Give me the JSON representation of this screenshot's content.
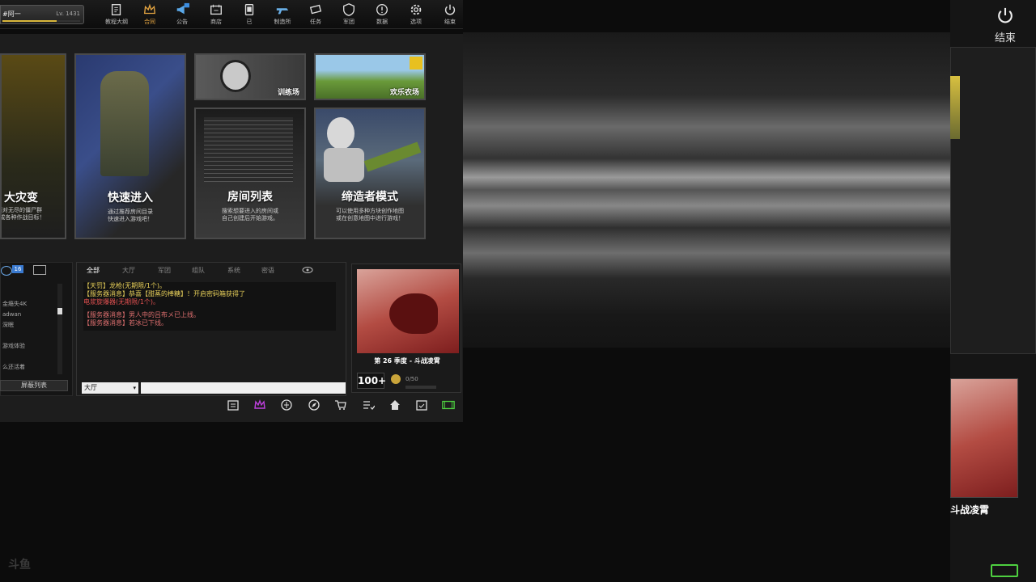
{
  "player": {
    "name": "#阿一",
    "level": "Lv. 1431",
    "exp_fraction": 0.7
  },
  "nav": [
    {
      "label": "教程大纲",
      "icon": "notepad-icon"
    },
    {
      "label": "合同",
      "icon": "crown-icon",
      "active": true
    },
    {
      "label": "公告",
      "icon": "megaphone-icon"
    },
    {
      "label": "商店",
      "icon": "cart-icon"
    },
    {
      "label": "已",
      "icon": "phone-icon"
    },
    {
      "label": "制造所",
      "icon": "gun-icon"
    },
    {
      "label": "任务",
      "icon": "ticket-icon"
    },
    {
      "label": "军团",
      "icon": "shield-icon"
    },
    {
      "label": "数据",
      "icon": "alert-icon"
    },
    {
      "label": "选项",
      "icon": "gear-icon"
    },
    {
      "label": "结束",
      "icon": "power-icon"
    }
  ],
  "exit_big": {
    "label": "结束"
  },
  "modes": {
    "zombie": {
      "title": "大灾变",
      "desc": "面对无尽的僵尸群\n完成各种作战目标！"
    },
    "quick": {
      "title": "快速进入",
      "desc": "通过推荐房间目录\n快速进入游戏吧！"
    },
    "rooms": {
      "title": "房间列表",
      "desc": "搜索想要进入的房间或\n自己创建后开始游戏。"
    },
    "creator": {
      "title": "缔造者模式",
      "desc": "可以使用多种方块创作地图\n或在创意地图中进行游戏！"
    },
    "training": {
      "title": "训练场"
    },
    "farm": {
      "title": "欢乐农场"
    }
  },
  "chat": {
    "tabs": [
      "全部",
      "大厅",
      "军团",
      "组队",
      "系统",
      "密语"
    ],
    "lines": [
      {
        "text": "【天罚】龙枪(无期限/1个)。",
        "color": "#e8d05a"
      },
      {
        "text": "【服务器消息】恭喜【甜蒸的棒糖】！开启密码箱获得了",
        "color": "#e8d05a"
      },
      {
        "text": "电浆旋爆器(无期限/1个)。",
        "color": "#e05050"
      },
      {
        "text": "【服务器消息】男人中的吕布メ已上线。",
        "color": "#e07070"
      },
      {
        "text": "【服务器消息】若冰已下线。",
        "color": "#e07070"
      }
    ],
    "channel": "大厅"
  },
  "friends": {
    "badge": "16",
    "items": [
      "金瘾失4K",
      "adwan",
      "深眠",
      "游戏体验",
      "么还活着"
    ],
    "block_label": "屏蔽列表"
  },
  "season": {
    "title": "第 26 季度 - 斗战凌霄",
    "level": "100+",
    "progress": "0/50"
  },
  "right_panel": {
    "season_title": "斗战凌霄"
  },
  "watermark": "斗鱼"
}
